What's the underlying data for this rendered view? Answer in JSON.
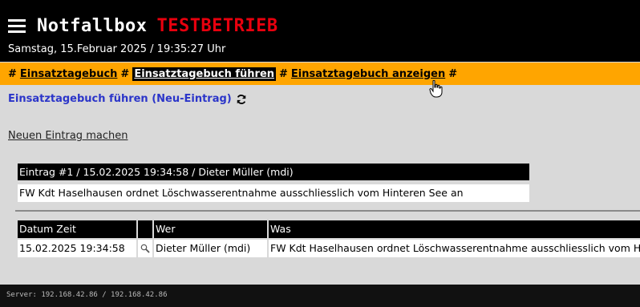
{
  "header": {
    "app_title": "Notfallbox",
    "mode_label": "TESTBETRIEB",
    "datetime": "Samstag, 15.Februar 2025 / 19:35:27 Uhr"
  },
  "nav": {
    "separator": "#",
    "items": [
      {
        "label": "Einsatztagebuch",
        "active": false
      },
      {
        "label": "Einsatztagebuch führen",
        "active": true
      },
      {
        "label": "Einsatztagebuch anzeigen",
        "active": false
      }
    ]
  },
  "page": {
    "heading": "Einsatztagebuch führen (Neu-Eintrag)",
    "new_entry_link": "Neuen Eintrag machen"
  },
  "entry": {
    "header": "Eintrag #1 / 15.02.2025 19:34:58 / Dieter Müller (mdi)",
    "body": "FW Kdt Haselhausen ordnet Löschwasserentnahme ausschliesslich vom Hinteren See an"
  },
  "table": {
    "columns": [
      "Datum Zeit",
      "",
      "Wer",
      "Was"
    ],
    "rows": [
      {
        "datum_zeit": "15.02.2025 19:34:58",
        "wer": "Dieter Müller (mdi)",
        "was": "FW Kdt Haselhausen ordnet Löschwasserentnahme ausschliesslich vom Hinteren See an"
      }
    ]
  },
  "footer": {
    "server_text": "Server: 192.168.42.86 / 192.168.42.86"
  },
  "colors": {
    "nav_background": "#ffa500",
    "mode_label": "#e8000e",
    "heading_link": "#2b35c9"
  },
  "icons": {
    "menu": "hamburger-menu-icon",
    "refresh": "refresh-icon",
    "details": "magnifier-icon",
    "cursor": "hand-pointer-cursor"
  }
}
